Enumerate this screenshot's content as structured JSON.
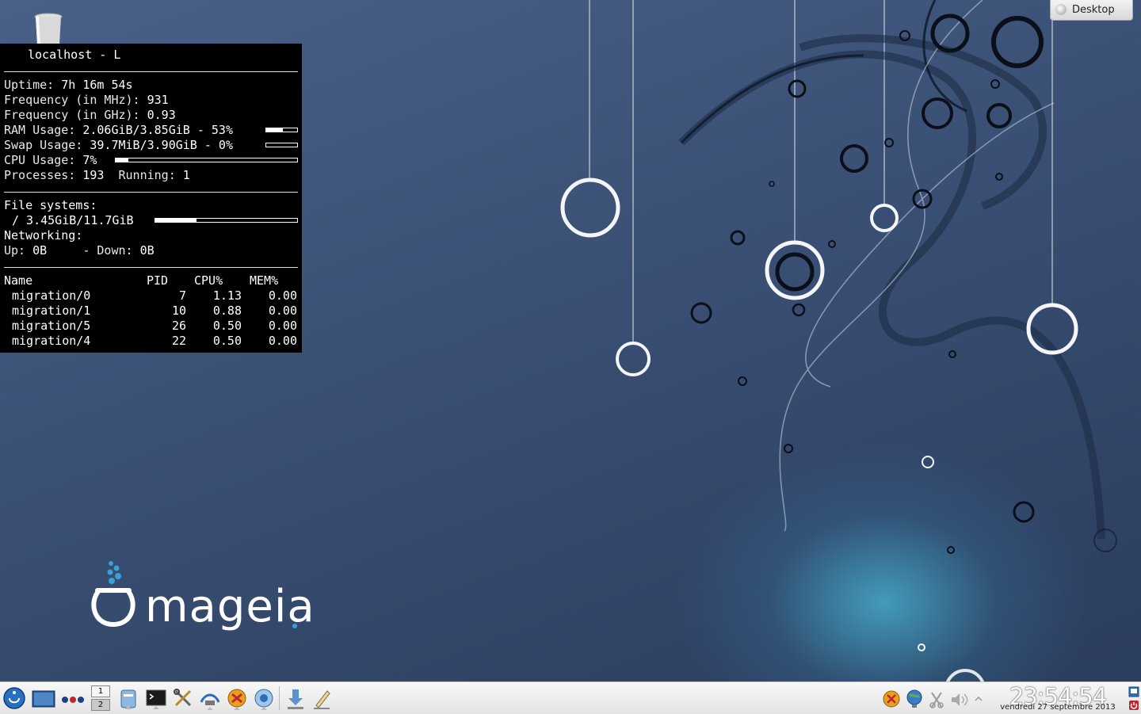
{
  "desktop": {
    "pager_button_label": "Desktop",
    "brand_text": "mageia"
  },
  "conky": {
    "host": "localhost - L",
    "uptime_label": "Uptime:",
    "uptime_value": "7h 16m 54s",
    "freq_mhz_label": "Frequency (in MHz):",
    "freq_mhz_value": "931",
    "freq_ghz_label": "Frequency (in GHz):",
    "freq_ghz_value": "0.93",
    "ram_label": "RAM Usage:",
    "ram_value": "2.06GiB/3.85GiB - 53%",
    "ram_percent": 53,
    "swap_label": "Swap Usage:",
    "swap_value": "39.7MiB/3.90GiB - 0%",
    "swap_percent": 0,
    "cpu_label": "CPU Usage:",
    "cpu_value": "7%",
    "cpu_percent": 7,
    "processes_label": "Processes:",
    "processes_value": "193",
    "running_label": "Running:",
    "running_value": "1",
    "fs_label": "File systems:",
    "fs_root": "/ 3.45GiB/11.7GiB",
    "fs_percent": 29,
    "net_label": "Networking:",
    "up_label": "Up:",
    "up_value": "0B",
    "down_label": "- Down:",
    "down_value": "0B",
    "table": {
      "headers": [
        "Name",
        "PID",
        "CPU%",
        "MEM%"
      ],
      "rows": [
        {
          "name": "migration/0",
          "pid": "7",
          "cpu": "1.13",
          "mem": "0.00"
        },
        {
          "name": "migration/1",
          "pid": "10",
          "cpu": "0.88",
          "mem": "0.00"
        },
        {
          "name": "migration/5",
          "pid": "26",
          "cpu": "0.50",
          "mem": "0.00"
        },
        {
          "name": "migration/4",
          "pid": "22",
          "cpu": "0.50",
          "mem": "0.00"
        }
      ]
    }
  },
  "taskbar": {
    "pager": [
      "1",
      "2"
    ],
    "clock_time": "23:54:54",
    "clock_date": "vendredi 27 septembre 2013",
    "launchers": [
      "app-menu-icon",
      "show-desktop-icon",
      "activities-icon",
      "file-manager-icon",
      "terminal-icon",
      "control-center-icon",
      "network-icon",
      "software-icon",
      "browser-icon",
      "download-icon",
      "text-editor-icon"
    ],
    "tray": [
      "update-icon",
      "network-tray-icon",
      "clipboard-icon",
      "volume-icon",
      "tray-expand-icon"
    ]
  },
  "colors": {
    "bg_top": "#4a6088",
    "bg_bottom": "#2b3c5c",
    "glow": "#46aac8",
    "conky_bg": "#000000",
    "taskbar": "#eeeeee"
  }
}
